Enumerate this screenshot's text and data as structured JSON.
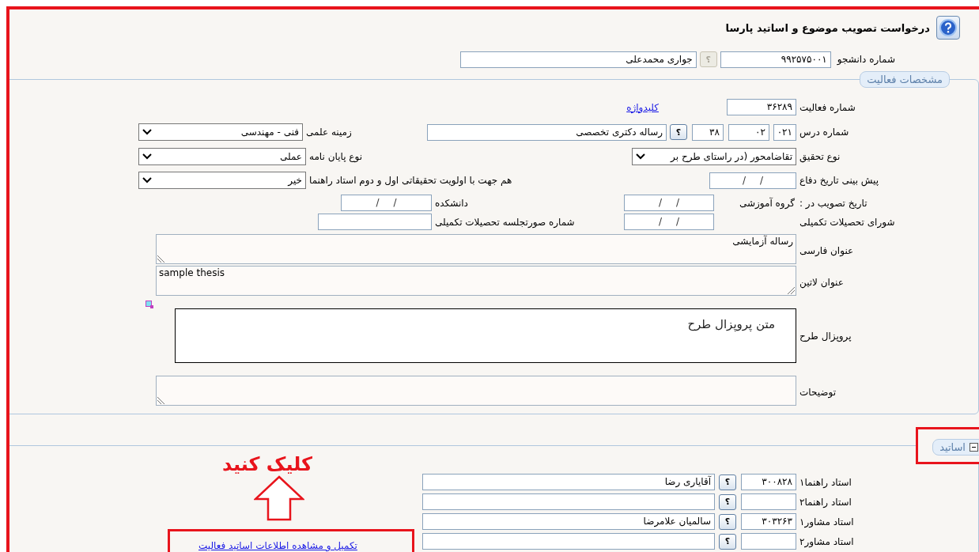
{
  "page": {
    "title": "درخواست تصویب موضوع و اساتید پارسا"
  },
  "student": {
    "label": "شماره دانشجو",
    "number": "۹۹۲۵۷۵۰۰۱",
    "lookup": {
      "glyph": "؟",
      "disabled": true
    },
    "name": "جواری محمدعلی"
  },
  "activity": {
    "legend": "مشخصات فعالیت",
    "activity_number": {
      "label": "شماره فعالیت",
      "value": "۳۶۲۸۹"
    },
    "keyword_link": "کلیدواژه",
    "course": {
      "label": "شماره درس",
      "parts": [
        "۰۲۱",
        "۰۲",
        "۳۸"
      ],
      "lookup": {
        "glyph": "؟",
        "disabled": false
      },
      "name": "رساله دکتری تخصصی"
    },
    "scientific_field": {
      "label": "زمینه علمی",
      "value": "فنی - مهندسی"
    },
    "research_type": {
      "label": "نوع تحقیق",
      "value": "تقاضامحور (در راستای طرح بر"
    },
    "thesis_type": {
      "label": "نوع پایان نامه",
      "value": "عملی"
    },
    "defense_date": {
      "label": "پیش بینی تاریخ دفاع",
      "value": "/ /"
    },
    "priority": {
      "label": "هم جهت با اولویت تحقیقاتی اول و دوم استاد راهنما",
      "value": "خیر"
    },
    "approval": {
      "label": "تاریخ تصویب در :",
      "group_label": "گروه آموزشی",
      "group_date": "/ /",
      "faculty_label": "دانشکده",
      "faculty_date": "/ /"
    },
    "council": {
      "label": "شورای تحصیلات تکمیلی",
      "date": "/ /",
      "minutes_label": "شماره صورتجلسه تحصیلات تکمیلی"
    },
    "persian_title": {
      "label": "عنوان فارسی",
      "value": "رساله آزمایشی"
    },
    "latin_title": {
      "label": "عنوان لاتین",
      "value": "sample thesis"
    },
    "proposal": {
      "label": "پروپزال طرح",
      "value": "متن پروپزال طرح"
    },
    "notes": {
      "label": "توضیحات"
    }
  },
  "professors": {
    "legend": "اساتید",
    "expanded": true,
    "rows": [
      {
        "label": "استاد راهنما۱",
        "code": "۳۰۰۸۲۸",
        "lookup": {
          "glyph": "؟",
          "disabled": false
        },
        "name": "آقایاری رضا"
      },
      {
        "label": "استاد راهنما۲",
        "lookup": {
          "glyph": "؟",
          "disabled": false
        }
      },
      {
        "label": "استاد مشاور۱",
        "code": "۳۰۳۲۶۳",
        "lookup": {
          "glyph": "؟",
          "disabled": false
        },
        "name": "سالمیان علامرضا"
      },
      {
        "label": "استاد مشاور۲",
        "lookup": {
          "glyph": "؟",
          "disabled": false
        }
      }
    ],
    "link": "تکمیل و مشاهده اطلاعات اساتید فعالیت"
  },
  "annotation": {
    "text": "کلیک کنید"
  }
}
